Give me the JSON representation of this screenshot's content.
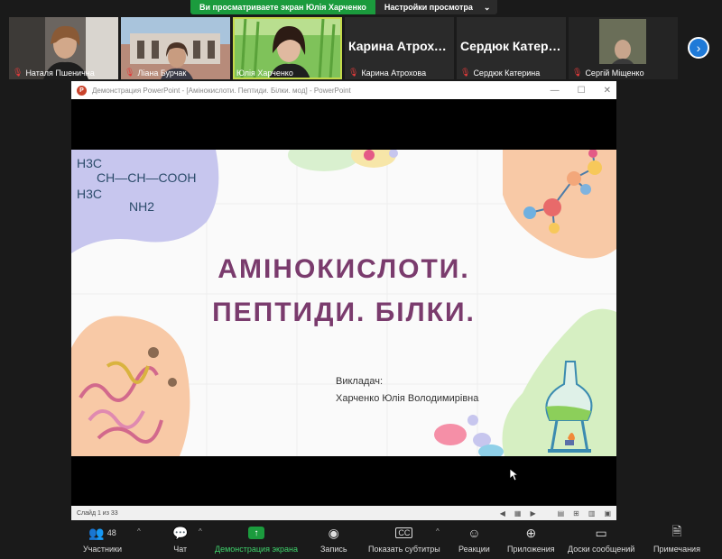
{
  "banner": {
    "viewing_text": "Ви просматриваете экран Юлія Харченко",
    "view_options": "Настройки просмотра"
  },
  "participants": [
    {
      "name": "Наталя Пшенична",
      "video": true
    },
    {
      "name": "Ліана Бурчак",
      "video": true
    },
    {
      "name": "Юлія Харченко",
      "video": true,
      "active": true
    },
    {
      "name": "Карина Атрохова",
      "display": "Карина  Атрохо...",
      "video": false
    },
    {
      "name": "Сердюк Катерина",
      "display": "Сердюк  Катери...",
      "video": false
    },
    {
      "name": "Сергій Міщенко",
      "video": true
    }
  ],
  "ppt": {
    "window_title": "Демонстрация PowerPoint - [Амінокислоти. Пептиди. Білки. мод] - PowerPoint",
    "slide": {
      "title_line1": "АМІНОКИСЛОТИ.",
      "title_line2": "ПЕПТИДИ. БІЛКИ.",
      "lecturer_label": "Викладач:",
      "lecturer_name": "Харченко Юлія Володимирівна",
      "formula": {
        "h3c_top": "H3C",
        "ch_chain": "CH—CH—COOH",
        "h3c_bottom": "H3C",
        "nh2": "NH2"
      }
    },
    "status": "Слайд 1 из 33"
  },
  "toolbar": {
    "participants_label": "Участники",
    "participants_count": "48",
    "chat_label": "Чат",
    "share_label": "Демонстрация экрана",
    "record_label": "Запись",
    "captions_label": "Показать субтитры",
    "reactions_label": "Реакции",
    "apps_label": "Приложения",
    "whiteboards_label": "Доски сообщений",
    "notes_label": "Примечания"
  },
  "colors": {
    "share_green": "#1b9b3d",
    "title_purple": "#7a3b6d",
    "active_outline": "#c4d94a",
    "next_blue": "#1f7ad8"
  }
}
